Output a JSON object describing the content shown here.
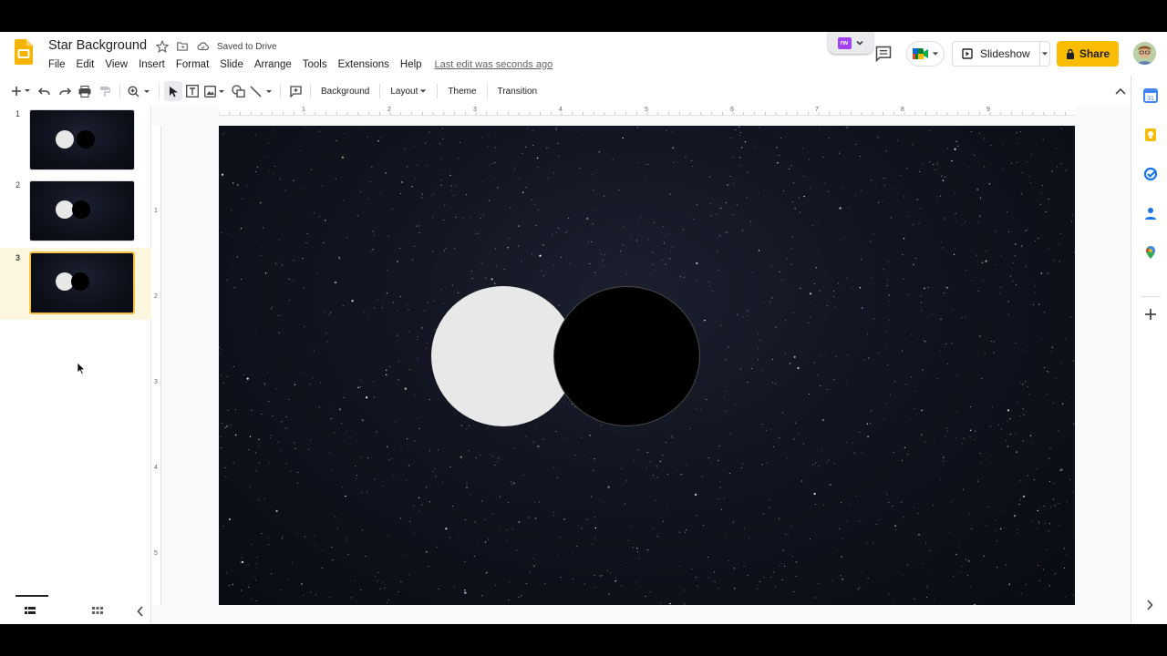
{
  "document": {
    "title": "Star Background",
    "saved_status": "Saved to Drive",
    "last_edit": "Last edit was seconds ago"
  },
  "menu": [
    "File",
    "Edit",
    "View",
    "Insert",
    "Format",
    "Slide",
    "Arrange",
    "Tools",
    "Extensions",
    "Help"
  ],
  "header_buttons": {
    "slideshow_label": "Slideshow",
    "share_label": "Share",
    "addon_label": "rw"
  },
  "toolbar": {
    "background_label": "Background",
    "layout_label": "Layout",
    "theme_label": "Theme",
    "transition_label": "Transition"
  },
  "slides": [
    {
      "number": "1",
      "selected": false
    },
    {
      "number": "2",
      "selected": false
    },
    {
      "number": "3",
      "selected": true
    }
  ],
  "ruler": {
    "horizontal": [
      "1",
      "2",
      "3",
      "4",
      "5",
      "6",
      "7",
      "8",
      "9"
    ],
    "vertical": [
      "1",
      "2",
      "3",
      "4",
      "5"
    ]
  },
  "colors": {
    "share_button": "#fbbc04",
    "selected_slide_border": "#f6c344",
    "selected_slide_bg": "#fef7e0",
    "white_circle": "#e8e8e8",
    "black_circle": "#000000"
  },
  "side_panel_icons": [
    "calendar-icon",
    "keep-icon",
    "tasks-icon",
    "contacts-icon",
    "maps-icon",
    "add-icon"
  ]
}
